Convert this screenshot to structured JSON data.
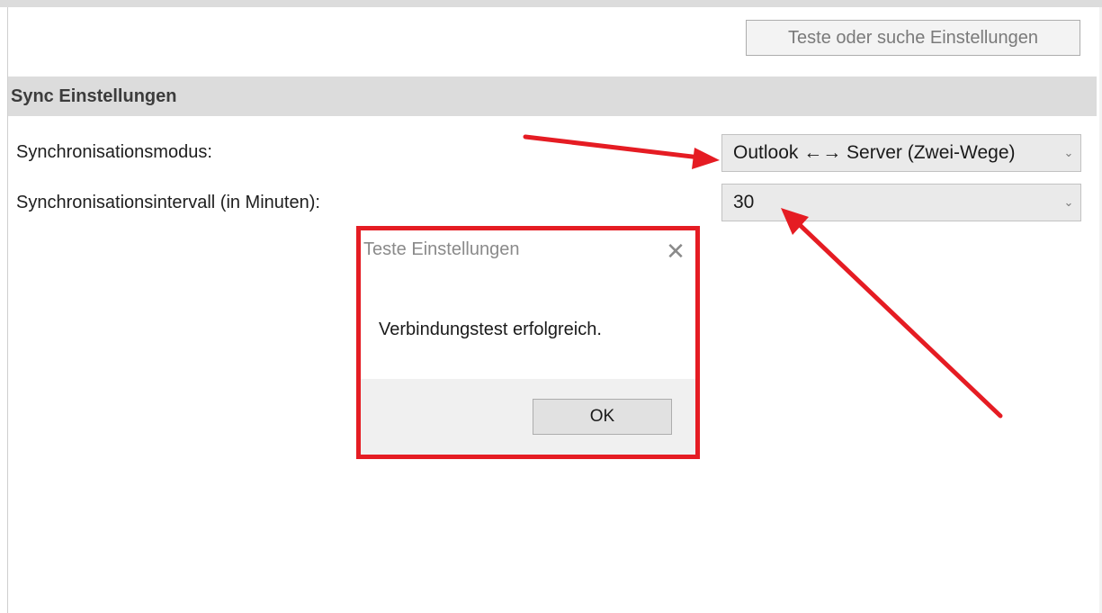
{
  "toolbar": {
    "test_button_label": "Teste oder suche Einstellungen"
  },
  "section": {
    "title": "Sync Einstellungen"
  },
  "fields": [
    {
      "label": "Synchronisationsmodus:",
      "value": "Outlook ←→ Server (Zwei-Wege)"
    },
    {
      "label": "Synchronisationsintervall (in Minuten):",
      "value": "30"
    }
  ],
  "dialog": {
    "title": "Teste Einstellungen",
    "close_glyph": "✕",
    "message": "Verbindungstest erfolgreich.",
    "ok_label": "OK"
  },
  "icons": {
    "dropdown": "chevron-down-icon",
    "close": "close-icon"
  },
  "colors": {
    "annotation_red": "#e51c23",
    "header_bg": "#dcdcdc"
  }
}
